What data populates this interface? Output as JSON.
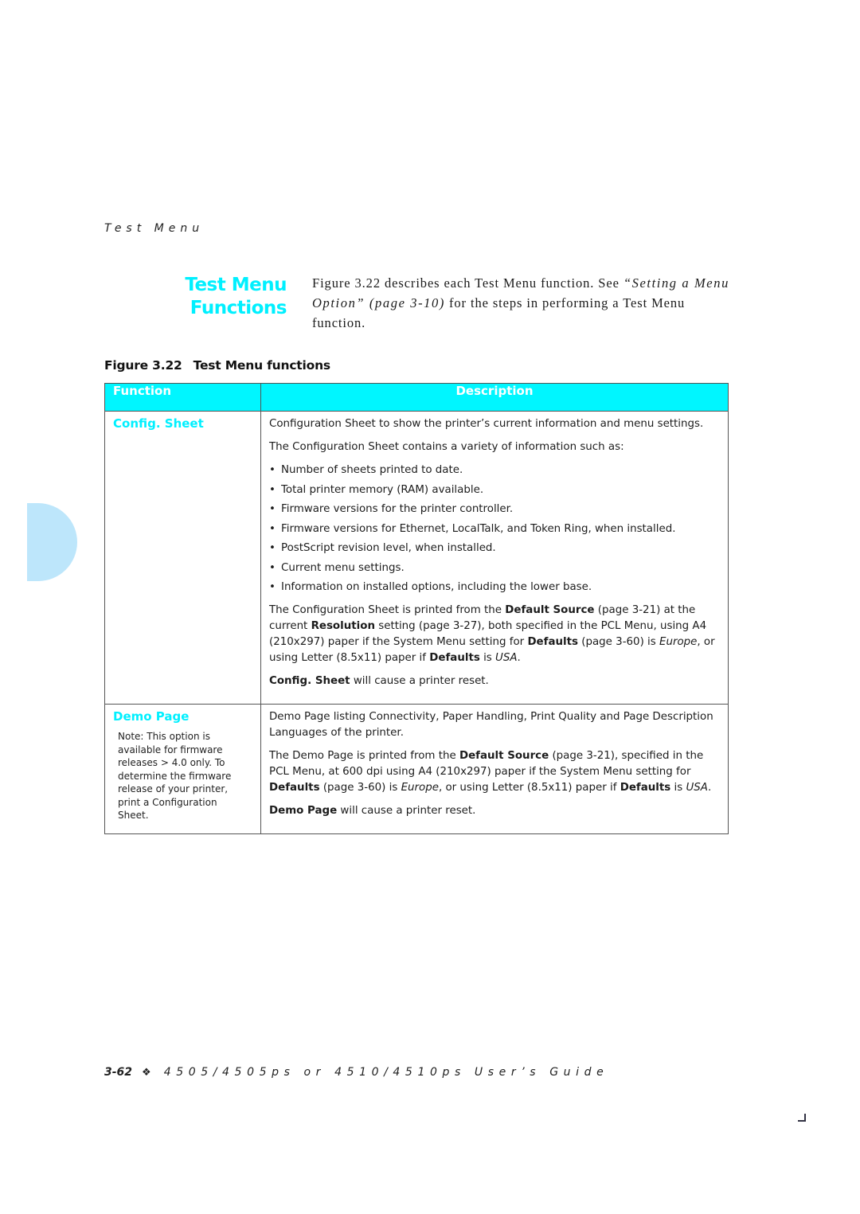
{
  "running_head": "Test Menu",
  "section_title": {
    "line1": "Test Menu",
    "line2": "Functions"
  },
  "intro": {
    "part1": "Figure 3.22 describes each Test Menu function. See ",
    "link": "“Setting a Menu Option” (page 3-10)",
    "part2": " for the steps in performing a Test Menu function."
  },
  "figure_caption": {
    "number": "Figure 3.22",
    "title": "Test Menu functions"
  },
  "table": {
    "headers": {
      "function": "Function",
      "description": "Description"
    },
    "rows": [
      {
        "function": "Config. Sheet",
        "intro": "Configuration Sheet to show the printer’s current information and menu settings.",
        "lead": "The Configuration Sheet contains a variety of information such as:",
        "bullets": [
          "Number of sheets printed to date.",
          "Total printer memory (RAM) available.",
          "Firmware versions for the printer controller.",
          "Firmware versions for Ethernet, LocalTalk, and Token Ring, when installed.",
          "PostScript revision level, when installed.",
          "Current menu settings.",
          "Information on installed options, including the lower base."
        ],
        "detail": {
          "t1": "The Configuration Sheet is printed from the ",
          "b1": "Default Source",
          "t2": " (page 3-21) at the current ",
          "b2": "Resolution",
          "t3": " setting (page 3-27), both specified in the PCL Menu, using A4 (210x297) paper if the System Menu setting for ",
          "b3": "Defaults",
          "t4": " (page 3-60) is ",
          "i1": "Europe",
          "t5": ", or using Letter (8.5x11) paper if ",
          "b4": "Defaults",
          "t6": " is ",
          "i2": "USA",
          "t7": "."
        },
        "reset": {
          "bold": "Config. Sheet",
          "rest": " will cause a printer reset."
        }
      },
      {
        "function": "Demo Page",
        "note": "Note: This option is available for firmware releases > 4.0 only. To determine the firmware release of your printer, print a Configuration Sheet.",
        "intro": "Demo Page listing Connectivity, Paper Handling, Print Quality and Page Description Languages of the printer.",
        "detail": {
          "t1": "The Demo Page is printed from the ",
          "b1": "Default Source",
          "t2": " (page 3-21), specified in the PCL Menu, at 600 dpi using A4 (210x297) paper if the System Menu setting for ",
          "b2": "Defaults",
          "t3": " (page 3-60) is ",
          "i1": "Europe",
          "t4": ", or using Letter (8.5x11) paper if ",
          "b3": "Defaults",
          "t5": " is ",
          "i2": "USA",
          "t6": "."
        },
        "reset": {
          "bold": "Demo Page",
          "rest": " will cause a printer reset."
        }
      }
    ]
  },
  "footer": {
    "page_number": "3-62",
    "separator_icon": "❖",
    "guide_title": "4505/4505ps or 4510/4510ps User’s Guide"
  },
  "colors": {
    "accent": "#00f0ff",
    "header_bg": "#00f6ff",
    "thumb_tab": "#bde6fb"
  }
}
